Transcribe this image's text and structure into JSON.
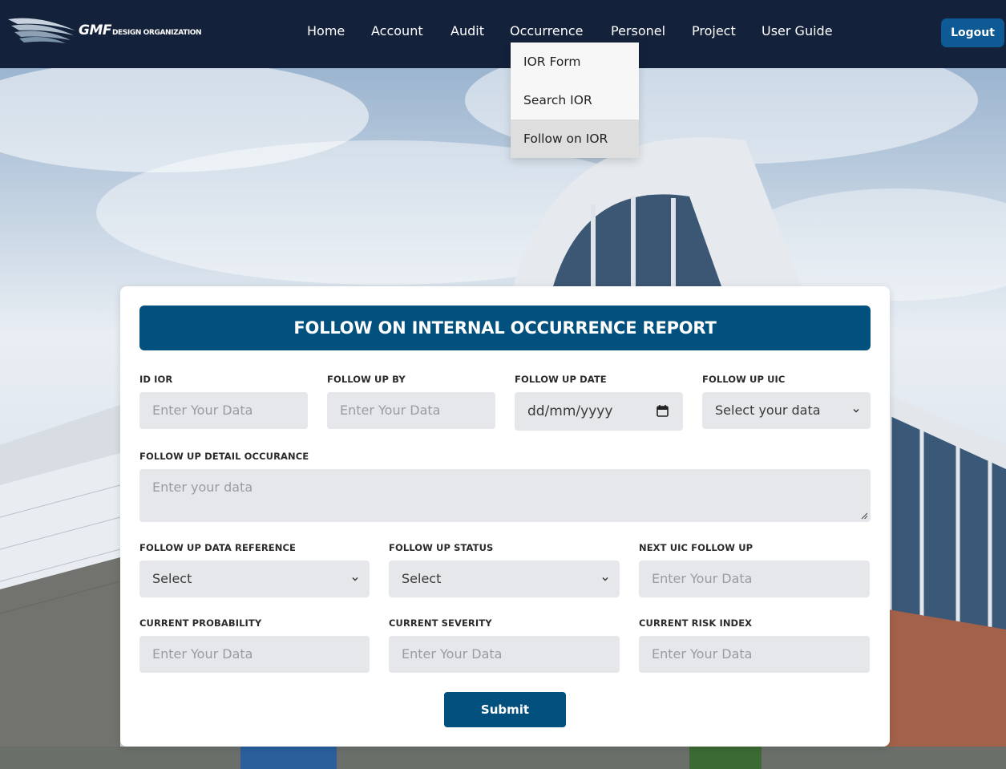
{
  "brand": {
    "logo_big": "GMF",
    "logo_small": "DESIGN ORGANIZATION"
  },
  "nav": {
    "items": [
      "Home",
      "Account",
      "Audit",
      "Occurrence",
      "Personel",
      "Project",
      "User Guide"
    ],
    "logout_label": "Logout"
  },
  "occurrence_menu": {
    "items": [
      "IOR Form",
      "Search IOR",
      "Follow on IOR"
    ],
    "active_index": 2
  },
  "form": {
    "title": "FOLLOW ON INTERNAL OCCURRENCE REPORT",
    "fields": {
      "id_ior": {
        "label": "ID IOR",
        "placeholder": "Enter Your Data"
      },
      "follow_up_by": {
        "label": "FOLLOW UP BY",
        "placeholder": "Enter Your Data"
      },
      "follow_up_date": {
        "label": "FOLLOW UP DATE",
        "placeholder": "dd/mm/yyyy"
      },
      "follow_up_uic": {
        "label": "FOLLOW UP UIC",
        "value": "Select your data"
      },
      "follow_up_detail": {
        "label": "FOLLOW UP DETAIL OCCURANCE",
        "placeholder": "Enter your data"
      },
      "follow_up_data_reference": {
        "label": "FOLLOW UP DATA REFERENCE",
        "value": "Select"
      },
      "follow_up_status": {
        "label": "FOLLOW UP STATUS",
        "value": "Select"
      },
      "next_uic_follow_up": {
        "label": "NEXT UIC FOLLOW UP",
        "placeholder": "Enter Your Data"
      },
      "current_probability": {
        "label": "CURRENT PROBABILITY",
        "placeholder": "Enter Your Data"
      },
      "current_severity": {
        "label": "CURRENT SEVERITY",
        "placeholder": "Enter Your Data"
      },
      "current_risk_index": {
        "label": "CURRENT RISK INDEX",
        "placeholder": "Enter Your Data"
      }
    },
    "submit_label": "Submit"
  },
  "colors": {
    "navbar": "#14213a",
    "primary": "#02507e",
    "logout": "#0e5a95",
    "field_bg": "#e6e7ea"
  }
}
